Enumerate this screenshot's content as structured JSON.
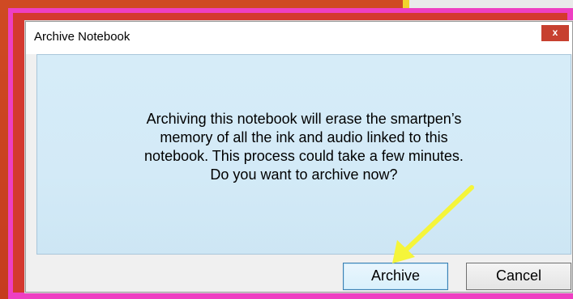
{
  "dialog": {
    "title": "Archive Notebook",
    "close_label": "x",
    "message_lines": [
      "Archiving this notebook will erase the smartpen’s",
      "memory of all the ink and audio linked to this",
      "notebook. This process could take a few minutes.",
      "Do you want to archive now?"
    ],
    "archive_label": "Archive",
    "cancel_label": "Cancel"
  },
  "annotation": {
    "arrow_color": "#f5f53a",
    "frame_color": "#ee3fc2"
  }
}
